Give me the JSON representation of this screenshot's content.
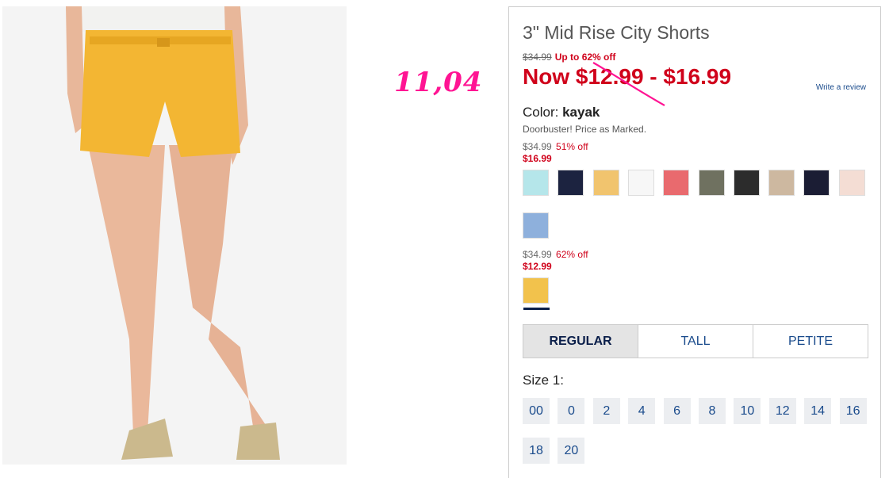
{
  "annotation": "11,04",
  "product": {
    "title": "3\" Mid Rise City Shorts",
    "original_price": "$34.99",
    "promo": "Up to 62% off",
    "now_price": "Now $12.99 - $16.99",
    "review_link": "Write a review",
    "color_label": "Color:",
    "color_name": "kayak",
    "note": "Doorbuster! Price as Marked."
  },
  "price_groups": [
    {
      "was": "$34.99",
      "pct": "51% off",
      "sale": "$16.99",
      "swatches": [
        {
          "name": "swatch-light-aqua",
          "color": "#b5e6ea"
        },
        {
          "name": "swatch-navy-pineapple",
          "color": "#1c2340"
        },
        {
          "name": "swatch-sand-yellow",
          "color": "#f1c46e"
        },
        {
          "name": "swatch-white",
          "color": "#f7f7f7"
        },
        {
          "name": "swatch-coral",
          "color": "#e96a6e"
        },
        {
          "name": "swatch-olive",
          "color": "#6f7160"
        },
        {
          "name": "swatch-charcoal",
          "color": "#2c2c2c"
        },
        {
          "name": "swatch-khaki",
          "color": "#cdb8a0"
        },
        {
          "name": "swatch-navy-dot",
          "color": "#1b1d34"
        },
        {
          "name": "swatch-pink-floral",
          "color": "#f4ddd4"
        },
        {
          "name": "swatch-blue-floral",
          "color": "#8eb0dc"
        }
      ]
    },
    {
      "was": "$34.99",
      "pct": "62% off",
      "sale": "$12.99",
      "swatches": [
        {
          "name": "swatch-kayak",
          "color": "#f2c24c",
          "selected": true
        }
      ]
    }
  ],
  "fit_tabs": [
    "REGULAR",
    "TALL",
    "PETITE"
  ],
  "size_label": "Size 1:",
  "sizes": [
    "00",
    "0",
    "2",
    "4",
    "6",
    "8",
    "10",
    "12",
    "14",
    "16",
    "18",
    "20"
  ]
}
